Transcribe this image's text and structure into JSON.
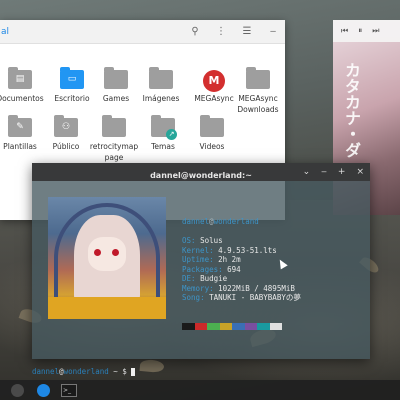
{
  "file_manager": {
    "location": "al",
    "items": [
      {
        "label": "Documentos",
        "icon": "document-folder-icon",
        "kind": "folder",
        "glyph": "▤"
      },
      {
        "label": "Escritorio",
        "icon": "desktop-folder-icon",
        "kind": "folder-blue",
        "glyph": "▭"
      },
      {
        "label": "Games",
        "icon": "games-folder-icon",
        "kind": "folder",
        "glyph": ""
      },
      {
        "label": "Imágenes",
        "icon": "pictures-folder-icon",
        "kind": "folder",
        "glyph": ""
      },
      {
        "label": "MEGAsync",
        "icon": "mega-icon",
        "kind": "mega",
        "glyph": "M"
      },
      {
        "label": "MEGAsync Downloads",
        "icon": "folder-icon",
        "kind": "folder",
        "glyph": ""
      },
      {
        "label": "Plantillas",
        "icon": "templates-folder-icon",
        "kind": "folder",
        "glyph": "✎"
      },
      {
        "label": "Público",
        "icon": "public-folder-icon",
        "kind": "folder",
        "glyph": "⚇"
      },
      {
        "label": "retrocitymap page",
        "icon": "folder-icon",
        "kind": "folder",
        "glyph": ""
      },
      {
        "label": "Temas",
        "icon": "shared-folder-icon",
        "kind": "folder-badge",
        "glyph": ""
      },
      {
        "label": "Videos",
        "icon": "videos-folder-icon",
        "kind": "folder",
        "glyph": ""
      }
    ],
    "tools": {
      "search": "⚲",
      "more": "⋮",
      "list": "☰",
      "minimize": "‒"
    }
  },
  "media": {
    "controls": {
      "prev": "⏮",
      "play": "⏸",
      "next": "⏭"
    },
    "art_text": "カタカナ・ダ"
  },
  "terminal": {
    "title": "dannel@wonderland:~",
    "controls": {
      "dropdown": "⌄",
      "minimize": "‒",
      "maximize": "+",
      "close": "×"
    },
    "header_user": "dannel",
    "header_at": "@",
    "header_host": "wonderland",
    "info": [
      {
        "key": "OS",
        "value": "Solus"
      },
      {
        "key": "Kernel",
        "value": "4.9.53-51.lts"
      },
      {
        "key": "Uptime",
        "value": "2h 2m"
      },
      {
        "key": "Packages",
        "value": "694"
      },
      {
        "key": "DE",
        "value": "Budgie"
      },
      {
        "key": "Memory",
        "value": "1022MiB / 4895MiB"
      },
      {
        "key": "Song",
        "value": "TANUKI - BABYBABYの夢"
      }
    ],
    "swatches": [
      "#1a1a1a",
      "#cc2a2a",
      "#4caf50",
      "#c9a227",
      "#3a6fb5",
      "#7a4fa0",
      "#1a9aa0",
      "#e0e0e0"
    ],
    "prompt_user": "dannel",
    "prompt_at": "@",
    "prompt_host": "wonderland",
    "prompt_tail": " ~ $ "
  },
  "taskbar": {
    "apps": [
      {
        "name": "budgie-menu-icon",
        "color": "#4a4a4a"
      },
      {
        "name": "downloader-icon",
        "color": "#1e88e5"
      },
      {
        "name": "terminal-icon",
        "color": "#1a1a1a"
      }
    ],
    "terminal_glyph": ">_"
  }
}
